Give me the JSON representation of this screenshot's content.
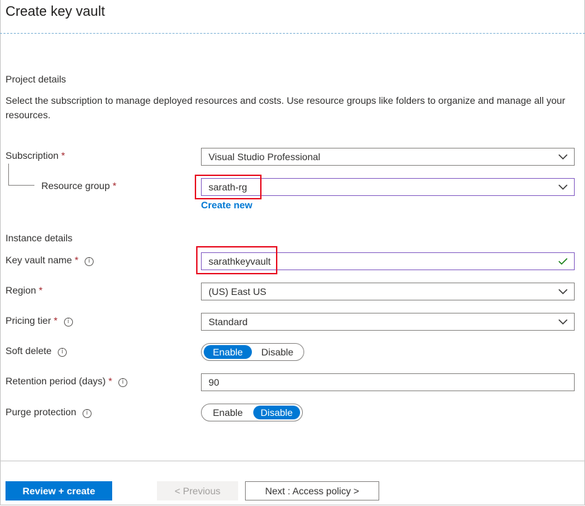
{
  "title": "Create key vault",
  "project": {
    "heading": "Project details",
    "description": "Select the subscription to manage deployed resources and costs. Use resource groups like folders to organize and manage all your resources."
  },
  "subscription": {
    "label": "Subscription",
    "required": "*",
    "value": "Visual Studio Professional"
  },
  "resource_group": {
    "label": "Resource group",
    "required": "*",
    "value": "sarath-rg",
    "create_new": "Create new"
  },
  "instance": {
    "heading": "Instance details"
  },
  "key_vault_name": {
    "label": "Key vault name",
    "required": "*",
    "info": "i",
    "value": "sarathkeyvault"
  },
  "region": {
    "label": "Region",
    "required": "*",
    "value": "(US) East US"
  },
  "pricing_tier": {
    "label": "Pricing tier",
    "required": "*",
    "info": "i",
    "value": "Standard"
  },
  "soft_delete": {
    "label": "Soft delete",
    "info": "i",
    "enable": "Enable",
    "disable": "Disable",
    "selected": "Enable"
  },
  "retention": {
    "label": "Retention period (days)",
    "required": "*",
    "info": "i",
    "value": "90"
  },
  "purge_protection": {
    "label": "Purge protection",
    "info": "i",
    "enable": "Enable",
    "disable": "Disable",
    "selected": "Disable"
  },
  "footer": {
    "review_create": "Review + create",
    "previous": "< Previous",
    "next": "Next : Access policy >"
  },
  "colors": {
    "accent": "#0078d4",
    "highlight": "#e81123",
    "focus": "#8661c5",
    "valid": "#107c10"
  }
}
